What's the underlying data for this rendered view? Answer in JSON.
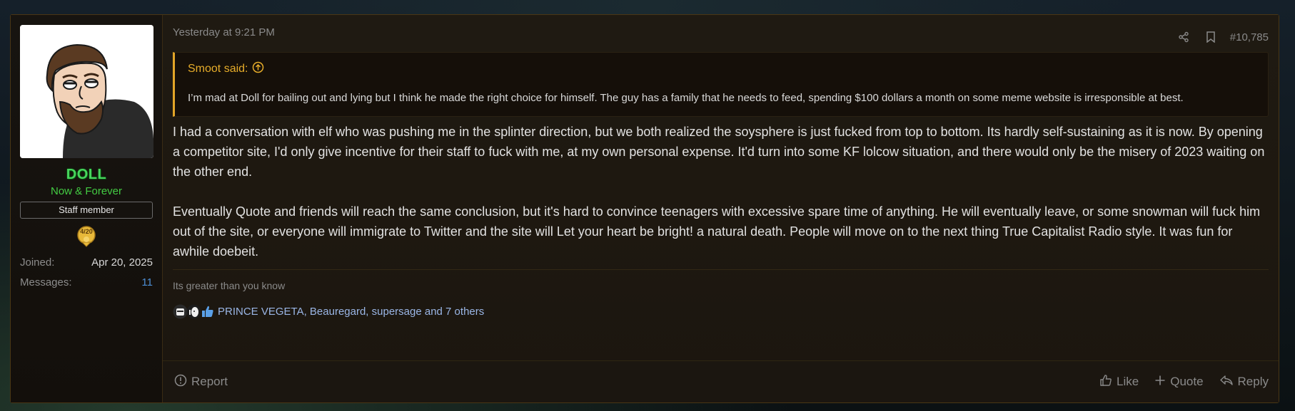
{
  "user": {
    "name": "DOLL",
    "title": "Now & Forever",
    "banner": "Staff member",
    "trophy_label": "4/20",
    "stats": [
      {
        "label": "Joined:",
        "value": "Apr 20, 2025"
      },
      {
        "label": "Messages:",
        "value": "11"
      }
    ]
  },
  "post": {
    "date": "Yesterday at 9:21 PM",
    "number": "#10,785",
    "quote": {
      "author": "Smoot said:",
      "text": "I’m mad at Doll for bailing out and lying but I think he made the right choice for himself. The guy has a family that he needs to feed, spending $100 dollars a month on some meme website is irresponsible at best."
    },
    "paragraphs": [
      "I had a conversation with elf who was pushing me in the splinter direction, but we both realized the soysphere is just fucked from top to bottom. Its hardly self-sustaining as it is now. By opening a competitor site, I'd only give incentive for their staff to fuck with me, at my own personal expense. It'd turn into some KF lolcow situation, and there would only be the misery of 2023 waiting on the other end.",
      "Eventually Quote and friends will reach the same conclusion, but it's hard to convince teenagers with excessive spare time of anything. He will eventually leave, or some snowman will fuck him out of the site, or everyone will immigrate to Twitter and the site will Let your heart be bright! a natural death. People will move on to the next thing True Capitalist Radio style. It was fun for awhile doebeit."
    ],
    "signature": "Its greater than you know",
    "reactions": {
      "names": "PRINCE VEGETA, Beauregard, supersage and 7 others"
    }
  },
  "footer": {
    "report": "Report",
    "like": "Like",
    "quote": "Quote",
    "reply": "Reply"
  },
  "colors": {
    "accent_quote": "#e2a528",
    "username": "#47d65d",
    "link": "#4c8ed4"
  }
}
